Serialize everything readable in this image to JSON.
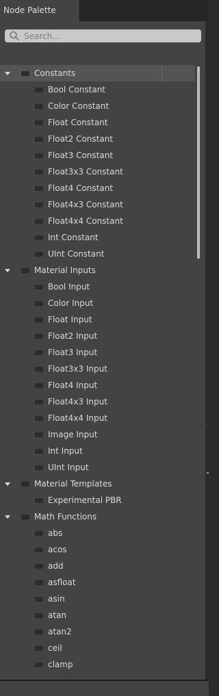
{
  "tab": {
    "title": "Node Palette"
  },
  "search": {
    "placeholder": "Search...",
    "value": ""
  },
  "scroll_position": 0,
  "categories": [
    {
      "label": "Constants",
      "selected": true,
      "items": [
        "Bool Constant",
        "Color Constant",
        "Float Constant",
        "Float2 Constant",
        "Float3 Constant",
        "Float3x3 Constant",
        "Float4 Constant",
        "Float4x3 Constant",
        "Float4x4 Constant",
        "Int Constant",
        "UInt Constant"
      ]
    },
    {
      "label": "Material Inputs",
      "selected": false,
      "items": [
        "Bool Input",
        "Color Input",
        "Float Input",
        "Float2 Input",
        "Float3 Input",
        "Float3x3 Input",
        "Float4 Input",
        "Float4x3 Input",
        "Float4x4 Input",
        "Image Input",
        "Int Input",
        "UInt Input"
      ]
    },
    {
      "label": "Material Templates",
      "selected": false,
      "items": [
        "Experimental PBR"
      ]
    },
    {
      "label": "Math Functions",
      "selected": false,
      "items": [
        "abs",
        "acos",
        "add",
        "asfloat",
        "asin",
        "atan",
        "atan2",
        "ceil",
        "clamp"
      ]
    }
  ],
  "colors": {
    "panel": "#434343",
    "selected_row": "#545454",
    "search_field": "#c9c9c9",
    "node_icon": "#2c2c2c"
  }
}
